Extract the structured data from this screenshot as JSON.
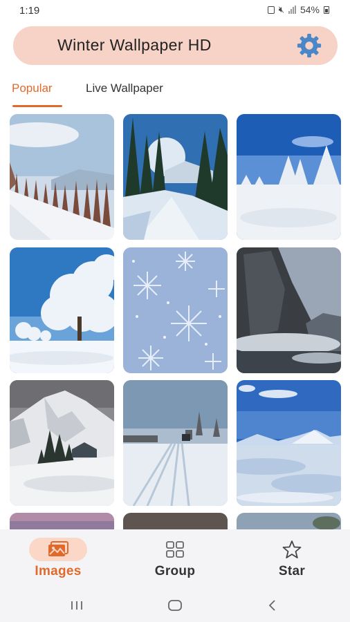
{
  "status_bar": {
    "time": "1:19",
    "battery": "54%"
  },
  "app_bar": {
    "title": "Winter Wallpaper HD",
    "settings_icon": "gear-icon",
    "background_color": "#f6d3c6",
    "icon_color": "#4a86c8"
  },
  "tabs": [
    {
      "label": "Popular",
      "active": true
    },
    {
      "label": "Live Wallpaper",
      "active": false
    }
  ],
  "accent_color": "#e06a2c",
  "wallpapers": [
    {
      "subject": "snowy-forest-slope"
    },
    {
      "subject": "pine-trees-sunburst"
    },
    {
      "subject": "snow-trees-blue-sky"
    },
    {
      "subject": "frosted-tree"
    },
    {
      "subject": "snowflake-pattern"
    },
    {
      "subject": "rocky-cliff-snow"
    },
    {
      "subject": "mountain-cabin"
    },
    {
      "subject": "snowy-road-tracks"
    },
    {
      "subject": "snowfield-mountains"
    }
  ],
  "bottom_nav": [
    {
      "label": "Images",
      "icon": "image-icon",
      "active": true
    },
    {
      "label": "Group",
      "icon": "grid-icon",
      "active": false
    },
    {
      "label": "Star",
      "icon": "star-icon",
      "active": false
    }
  ],
  "system_nav": [
    "recents-icon",
    "home-icon",
    "back-icon"
  ]
}
